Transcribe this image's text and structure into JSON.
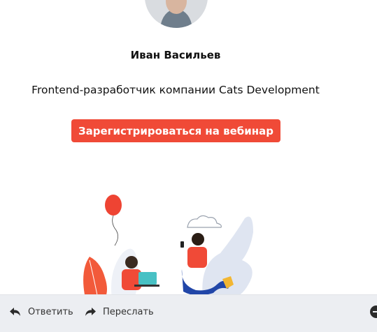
{
  "speaker": {
    "name": "Иван Васильев",
    "role": "Frontend-разработчик компании Cats Development"
  },
  "cta": {
    "label": "Зарегистрироваться на вебинар",
    "color": "#f04a37"
  },
  "illustration": {
    "icons": [
      "balloon-icon",
      "laptop-icon",
      "phone-icon",
      "cloud-icon",
      "leaf-icon"
    ]
  },
  "footer": {
    "reply_label": "Ответить",
    "forward_label": "Переслать",
    "reply_icon": "reply-icon",
    "forward_icon": "forward-icon",
    "more_icon": "more-icon"
  }
}
